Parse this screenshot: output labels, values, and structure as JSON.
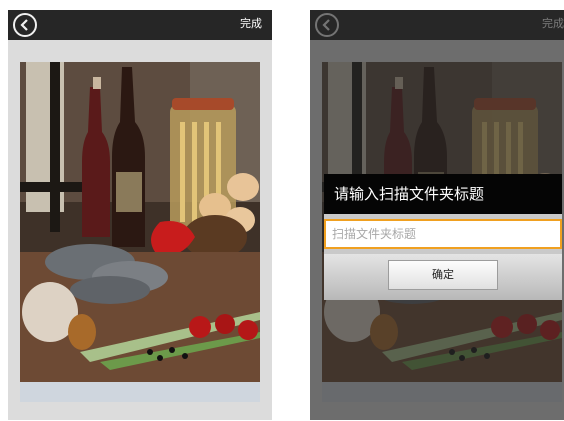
{
  "left_screen": {
    "back_icon": "chevron-left-icon",
    "done_label": "完成"
  },
  "right_screen": {
    "back_icon": "chevron-left-icon",
    "done_label": "完成",
    "dialog": {
      "title": "请输入扫描文件夹标题",
      "input_placeholder": "扫描文件夹标题",
      "ok_label": "确定"
    }
  },
  "colors": {
    "top_bar": "#262626",
    "input_focus_border": "#f0a020",
    "dialog_title_bar": "#050505"
  }
}
